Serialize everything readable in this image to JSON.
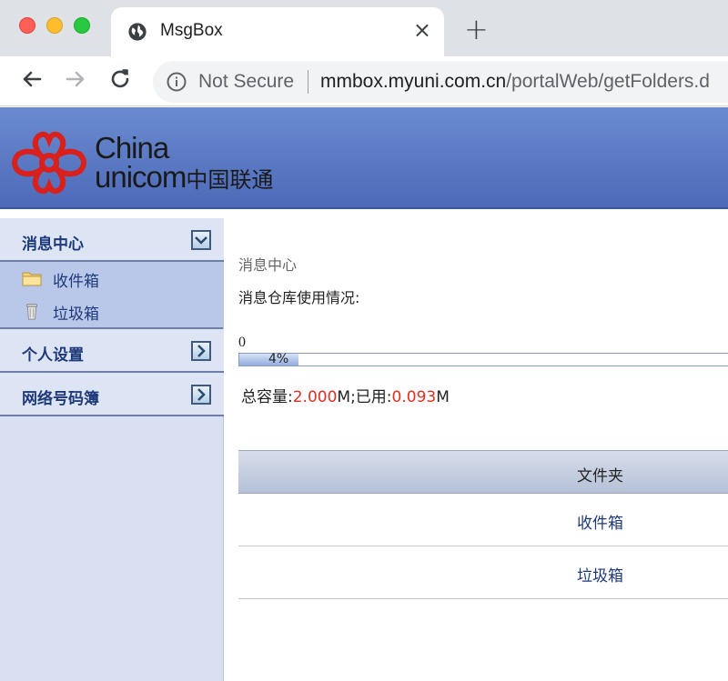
{
  "browser": {
    "tab_title": "MsgBox",
    "tab_close": "×",
    "new_tab": "+",
    "security_label": "Not Secure",
    "url_host": "mmbox.myuni.com.cn",
    "url_path": "/portalWeb/getFolders.d"
  },
  "header": {
    "logo_en_1": "China",
    "logo_en_2": "unicom",
    "logo_cn": "中国联通",
    "brand_color": "#d8201c"
  },
  "sidebar": {
    "sections": [
      {
        "label": "消息中心",
        "items": [
          {
            "label": "收件箱",
            "icon": "folder-icon"
          },
          {
            "label": "垃圾箱",
            "icon": "trash-icon"
          }
        ]
      },
      {
        "label": "个人设置"
      },
      {
        "label": "网络号码簿"
      }
    ]
  },
  "main": {
    "breadcrumb": "消息中心",
    "usage_title": "消息仓库使用情况:",
    "usage_min": "0",
    "usage_percent": 4,
    "usage_percent_label": "4%",
    "capacity_label": "总容量:",
    "capacity_value": "2.000",
    "unit": "M",
    "used_label": ";已用:",
    "used_value": "0.093",
    "folders_header": "文件夹",
    "folders": [
      "收件箱",
      "垃圾箱"
    ],
    "accent_red": "#e03020"
  }
}
